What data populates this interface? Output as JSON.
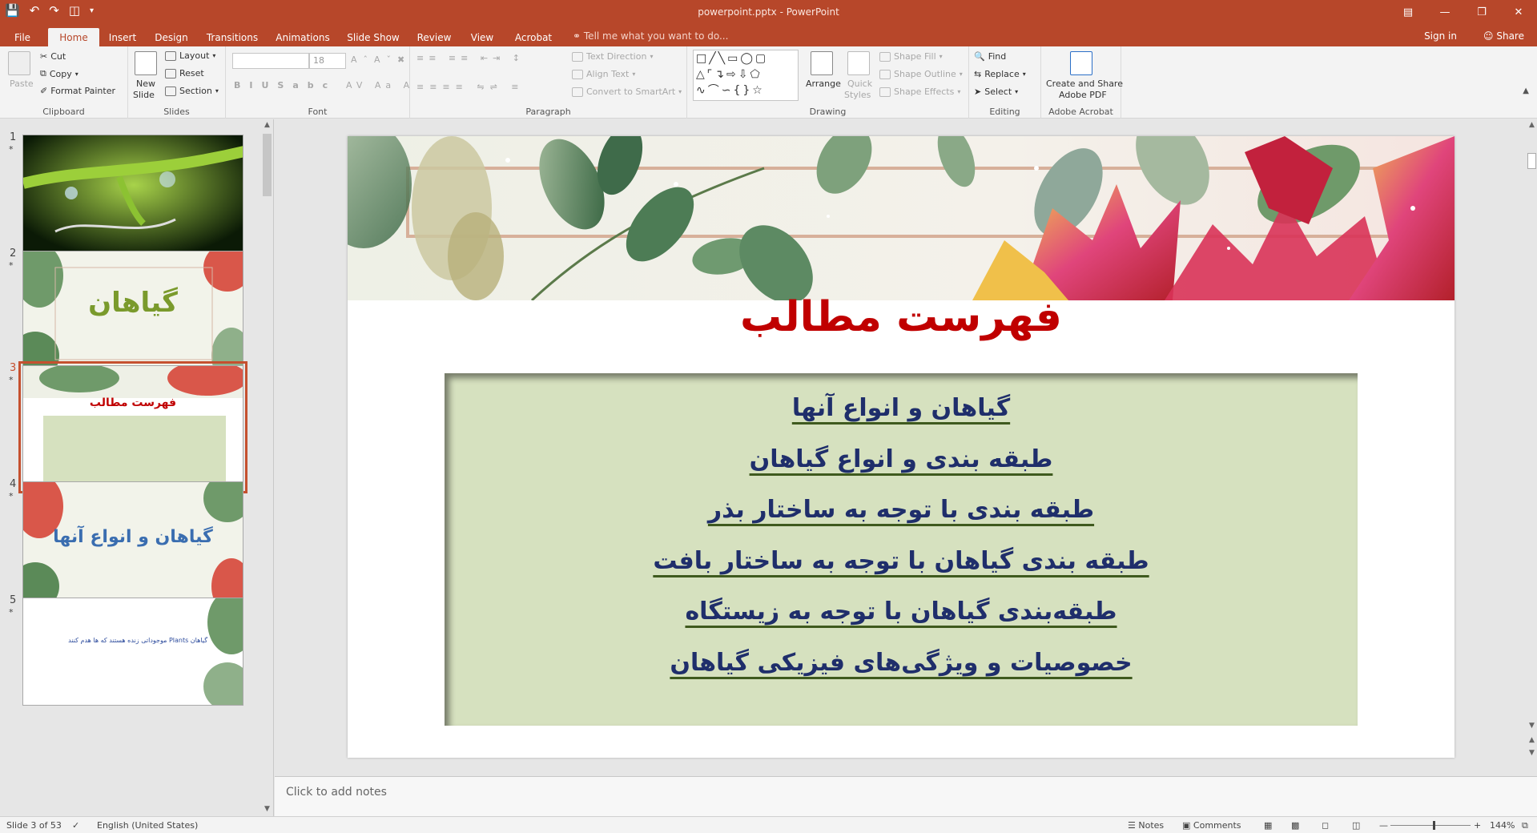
{
  "window": {
    "title": "powerpoint.pptx - PowerPoint"
  },
  "tabs": [
    {
      "label": "File"
    },
    {
      "label": "Home"
    },
    {
      "label": "Insert"
    },
    {
      "label": "Design"
    },
    {
      "label": "Transitions"
    },
    {
      "label": "Animations"
    },
    {
      "label": "Slide Show"
    },
    {
      "label": "Review"
    },
    {
      "label": "View"
    },
    {
      "label": "Acrobat"
    }
  ],
  "tellme": "Tell me what you want to do...",
  "signin": "Sign in",
  "share": "Share",
  "ribbon": {
    "clipboard": {
      "label": "Clipboard",
      "paste": "Paste",
      "cut": "Cut",
      "copy": "Copy",
      "format_painter": "Format Painter"
    },
    "slides": {
      "label": "Slides",
      "new_slide_1": "New",
      "new_slide_2": "Slide",
      "layout": "Layout",
      "reset": "Reset",
      "section": "Section"
    },
    "font": {
      "label": "Font",
      "size": "18"
    },
    "paragraph": {
      "label": "Paragraph",
      "text_direction": "Text Direction",
      "align_text": "Align Text",
      "convert_smartart": "Convert to SmartArt"
    },
    "drawing": {
      "label": "Drawing",
      "arrange": "Arrange",
      "quick_styles_1": "Quick",
      "quick_styles_2": "Styles",
      "shape_fill": "Shape Fill",
      "shape_outline": "Shape Outline",
      "shape_effects": "Shape Effects"
    },
    "editing": {
      "label": "Editing",
      "find": "Find",
      "replace": "Replace",
      "select": "Select"
    },
    "acrobat": {
      "label": "Adobe Acrobat",
      "create_1": "Create and Share",
      "create_2": "Adobe PDF"
    }
  },
  "thumbnails": [
    {
      "num": "1",
      "text": ""
    },
    {
      "num": "2",
      "text": "گیاهان"
    },
    {
      "num": "3",
      "text": "فهرست مطالب"
    },
    {
      "num": "4",
      "text": "گیاهان و انواع آنها"
    },
    {
      "num": "5",
      "text": "گیاهان Plants موجوداتی زنده هستند که ها هدم کنند"
    }
  ],
  "slide": {
    "title": "فهرست مطالب",
    "items": [
      "گیاهان و انواع آنها",
      "طبقه بندی و انواع گیاهان",
      "طبقه بندی با توجه به ساختار بذر",
      "طبقه بندی گیاهان با توجه به ساختار بافت",
      "طبقه‌بندی گیاهان با توجه به زیستگاه",
      "خصوصیات و ویژگی‌های فیزیکی گیاهان"
    ]
  },
  "notes_placeholder": "Click to add notes",
  "status": {
    "slide_info": "Slide 3 of 53",
    "language": "English (United States)",
    "notes": "Notes",
    "comments": "Comments",
    "zoom": "144%"
  },
  "colors": {
    "accent": "#b7472a",
    "title_red": "#c00000",
    "toc_blue": "#1f2e6b",
    "box_green": "#d6e1bf"
  }
}
